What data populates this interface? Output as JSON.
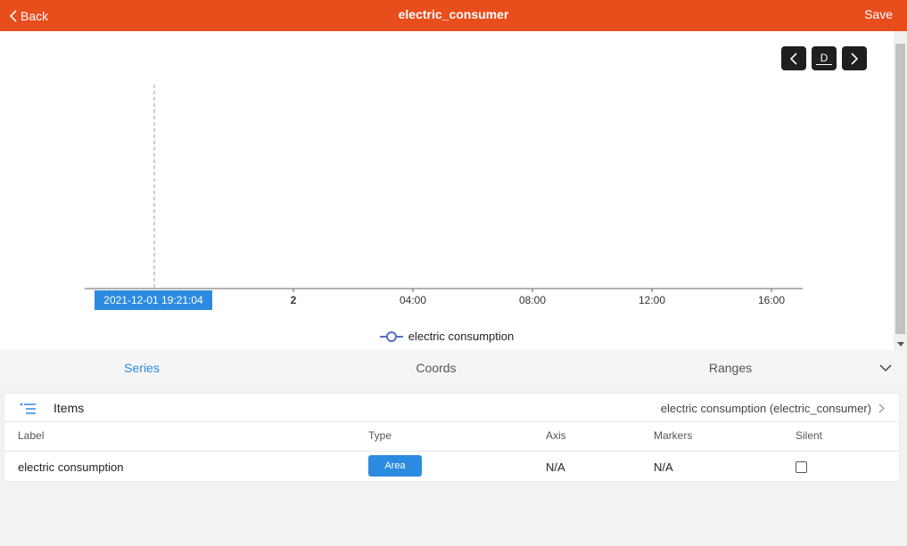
{
  "header": {
    "back_label": "Back",
    "title": "electric_consumer",
    "save_label": "Save"
  },
  "toolbar": {
    "period_label": "D"
  },
  "chart_data": {
    "type": "area",
    "x_ticks": [
      "2",
      "04:00",
      "08:00",
      "12:00",
      "16:00"
    ],
    "cursor_label": "2021-12-01 19:21:04",
    "series": [
      {
        "name": "electric consumption",
        "values": []
      }
    ],
    "legend_position": "bottom-center",
    "colors": {
      "axis": "#666666",
      "cursor_badge": "#2b8be0",
      "legend_marker": "#5470c6"
    }
  },
  "tabs": [
    {
      "label": "Series",
      "active": true
    },
    {
      "label": "Coords",
      "active": false
    },
    {
      "label": "Ranges",
      "active": false
    }
  ],
  "items": {
    "title": "Items",
    "link_label": "electric consumption (electric_consumer)",
    "columns": [
      "Label",
      "Type",
      "Axis",
      "Markers",
      "Silent"
    ],
    "rows": [
      {
        "label": "electric consumption",
        "type": "Area",
        "axis": "N/A",
        "markers": "N/A",
        "silent": false
      }
    ]
  },
  "colors": {
    "header": "#e84d1c",
    "accent": "#2b8be0"
  }
}
